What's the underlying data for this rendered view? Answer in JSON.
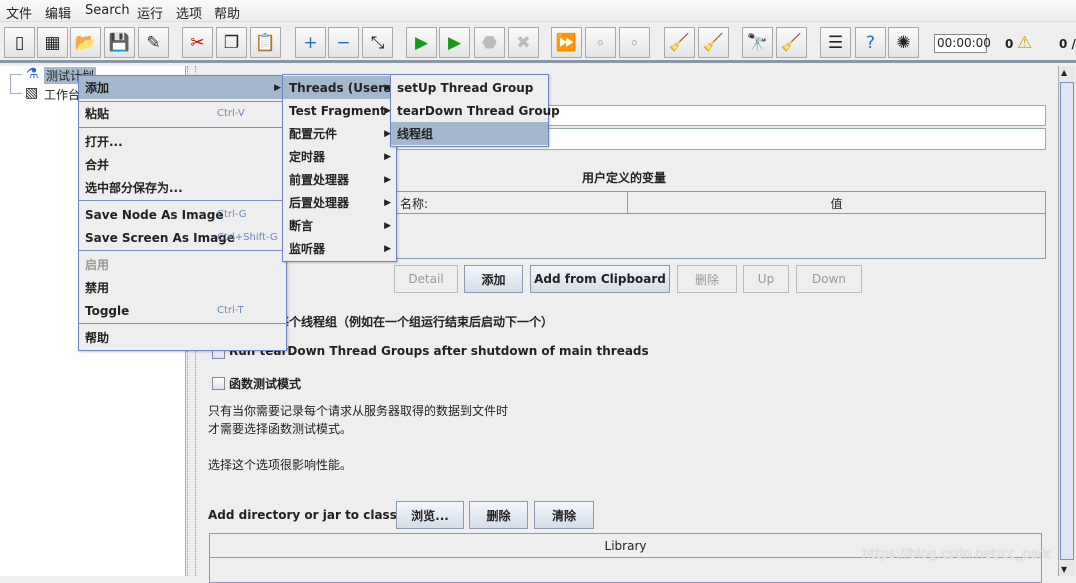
{
  "menubar": {
    "items": [
      "文件",
      "编辑",
      "Search",
      "运行",
      "选项",
      "帮助"
    ]
  },
  "toolbar": {
    "buttons": [
      {
        "icon": "new-icon",
        "glyph": "▯"
      },
      {
        "icon": "templates-icon",
        "glyph": "▦"
      },
      {
        "icon": "open-icon",
        "glyph": "📂"
      },
      {
        "icon": "save-icon",
        "glyph": "💾"
      },
      {
        "icon": "save-as-icon",
        "glyph": "✎"
      },
      {
        "icon": "cut-icon",
        "glyph": "✂"
      },
      {
        "icon": "copy-icon",
        "glyph": "❐"
      },
      {
        "icon": "paste-icon",
        "glyph": "📋"
      },
      {
        "icon": "expand-icon",
        "glyph": "+"
      },
      {
        "icon": "collapse-icon",
        "glyph": "−"
      },
      {
        "icon": "toggle-icon",
        "glyph": "⤡"
      },
      {
        "icon": "start-icon",
        "glyph": "▶"
      },
      {
        "icon": "start-no-pause-icon",
        "glyph": "▶"
      },
      {
        "icon": "stop-icon",
        "glyph": "⬣",
        "disabled": true
      },
      {
        "icon": "shutdown-icon",
        "glyph": "✖",
        "disabled": true
      },
      {
        "icon": "remote-start-icon",
        "glyph": "⏩"
      },
      {
        "icon": "remote-stop-icon",
        "glyph": "∘",
        "disabled": true
      },
      {
        "icon": "remote-shutdown-icon",
        "glyph": "∘",
        "disabled": true
      },
      {
        "icon": "clear-icon",
        "glyph": "🧹"
      },
      {
        "icon": "clear-all-icon",
        "glyph": "🧹"
      },
      {
        "icon": "search-icon",
        "glyph": "🔭"
      },
      {
        "icon": "reset-search-icon",
        "glyph": "🧹"
      },
      {
        "icon": "function-helper-icon",
        "glyph": "☰"
      },
      {
        "icon": "help-icon",
        "glyph": "?"
      },
      {
        "icon": "logger-icon",
        "glyph": "✺"
      }
    ],
    "timer": "00:00:00",
    "warning_count": "0",
    "thread_count": "0 /"
  },
  "tree": {
    "items": [
      {
        "label": "测试计划",
        "selected": true
      },
      {
        "label": "工作台"
      }
    ]
  },
  "context_menu": {
    "items": [
      {
        "label": "添加",
        "submenu": true,
        "highlighted": true
      },
      {
        "label": "粘贴",
        "shortcut": "Ctrl-V"
      },
      {
        "label": "打开..."
      },
      {
        "label": "合并"
      },
      {
        "label": "选中部分保存为..."
      },
      {
        "label": "Save Node As Image",
        "shortcut": "Ctrl-G"
      },
      {
        "label": "Save Screen As Image",
        "shortcut": "Ctrl+Shift-G"
      },
      {
        "label": "启用",
        "disabled": true
      },
      {
        "label": "禁用"
      },
      {
        "label": "Toggle",
        "shortcut": "Ctrl-T"
      },
      {
        "label": "帮助"
      }
    ]
  },
  "add_submenu": {
    "items": [
      "Threads (Users)",
      "Test Fragment",
      "配置元件",
      "定时器",
      "前置处理器",
      "后置处理器",
      "断言",
      "监听器"
    ]
  },
  "threads_submenu": {
    "items": [
      "setUp Thread Group",
      "tearDown Thread Group",
      "线程组"
    ]
  },
  "main": {
    "variables_title": "用户定义的变量",
    "table_headers": [
      "名称:",
      "值"
    ],
    "buttons": [
      {
        "label": "Detail",
        "disabled": true
      },
      {
        "label": "添加"
      },
      {
        "label": "Add from Clipboard"
      },
      {
        "label": "删除",
        "disabled": true
      },
      {
        "label": "Up",
        "disabled": true
      },
      {
        "label": "Down",
        "disabled": true
      }
    ],
    "checkbox_serialize": "独立运行每个线程组（例如在一个组运行结束后启动下一个）",
    "checkbox_teardown": "Run tearDown Thread Groups after shutdown of main threads",
    "checkbox_functional": "函数测试模式",
    "help_line1": "只有当你需要记录每个请求从服务器取得的数据到文件时",
    "help_line2": "才需要选择函数测试模式。",
    "help_line3": "选择这个选项很影响性能。",
    "classpath_label": "Add directory or jar to classpath",
    "classpath_buttons": [
      "浏览...",
      "删除",
      "清除"
    ],
    "library_header": "Library"
  },
  "watermark": "https://blog.csdn.net/cc_park"
}
